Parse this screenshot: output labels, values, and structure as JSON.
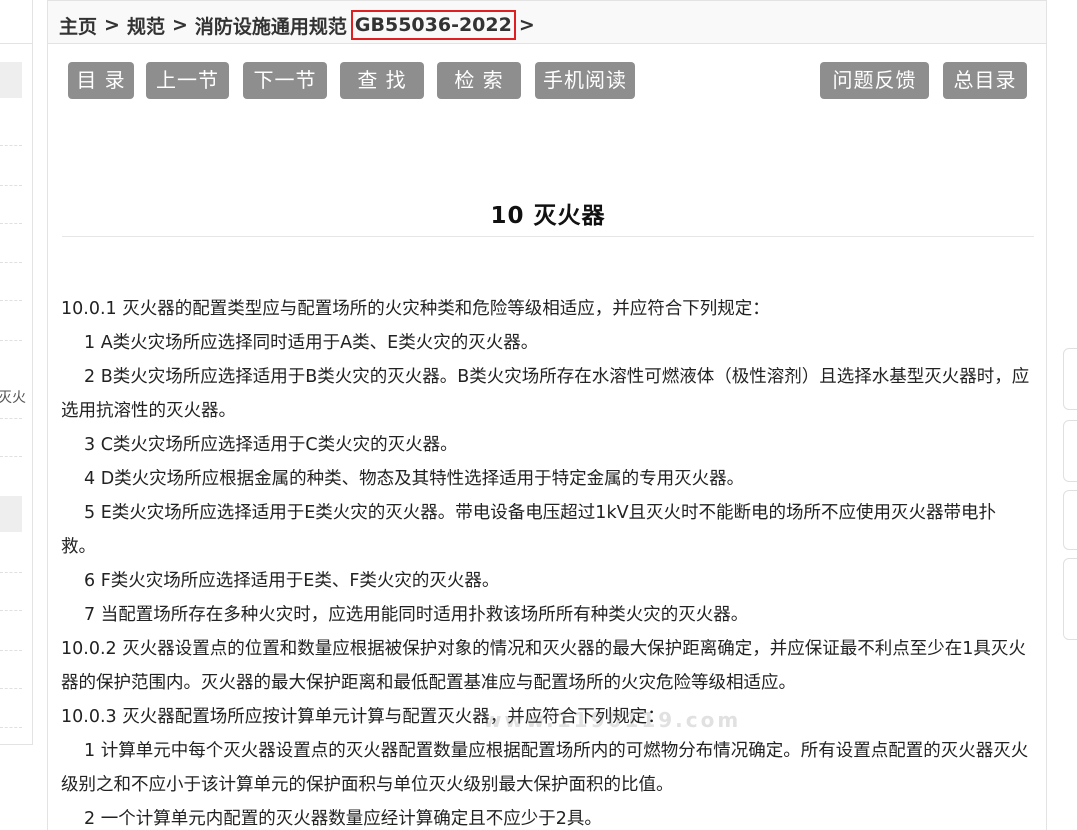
{
  "breadcrumb": {
    "home": "主页",
    "standards": "规范",
    "category": "消防设施通用规范",
    "code": "GB55036-2022",
    "separator": ">"
  },
  "toolbar": {
    "toc": "目 录",
    "prev": "上一节",
    "next": "下一节",
    "find": "查 找",
    "search": "检 索",
    "mobile": "手机阅读",
    "feedback": "问题反馈",
    "master_toc": "总目录"
  },
  "sidebar": {
    "cut_glyph": "灭火"
  },
  "chapter": {
    "title": "10 灭火器"
  },
  "content": [
    {
      "type": "clause",
      "text": "10.0.1 灭火器的配置类型应与配置场所的火灾种类和危险等级相适应，并应符合下列规定："
    },
    {
      "type": "item",
      "text": "1 A类火灾场所应选择同时适用于A类、E类火灾的灭火器。"
    },
    {
      "type": "item",
      "text": "2 B类火灾场所应选择适用于B类火灾的灭火器。B类火灾场所存在水溶性可燃液体（极性溶剂）且选择水基型灭火器时，应选用抗溶性的灭火器。"
    },
    {
      "type": "item",
      "text": "3 C类火灾场所应选择适用于C类火灾的灭火器。"
    },
    {
      "type": "item",
      "text": "4 D类火灾场所应根据金属的种类、物态及其特性选择适用于特定金属的专用灭火器。"
    },
    {
      "type": "item",
      "text": "5 E类火灾场所应选择适用于E类火灾的灭火器。带电设备电压超过1kV且灭火时不能断电的场所不应使用灭火器带电扑救。"
    },
    {
      "type": "item",
      "text": "6 F类火灾场所应选择适用于E类、F类火灾的灭火器。"
    },
    {
      "type": "item",
      "text": "7 当配置场所存在多种火灾时，应选用能同时适用扑救该场所所有种类火灾的灭火器。"
    },
    {
      "type": "clause",
      "text": "10.0.2 灭火器设置点的位置和数量应根据被保护对象的情况和灭火器的最大保护距离确定，并应保证最不利点至少在1具灭火器的保护范围内。灭火器的最大保护距离和最低配置基准应与配置场所的火灾危险等级相适应。"
    },
    {
      "type": "clause",
      "text": "10.0.3 灭火器配置场所应按计算单元计算与配置灭火器，并应符合下列规定："
    },
    {
      "type": "item",
      "text": "1 计算单元中每个灭火器设置点的灭火器配置数量应根据配置场所内的可燃物分布情况确定。所有设置点配置的灭火器灭火级别之和不应小于该计算单元的保护面积与单位灭火级别最大保护面积的比值。"
    },
    {
      "type": "item",
      "text": "2 一个计算单元内配置的灭火器数量应经计算确定且不应少于2具。"
    }
  ],
  "watermark": "www.1190119.com"
}
